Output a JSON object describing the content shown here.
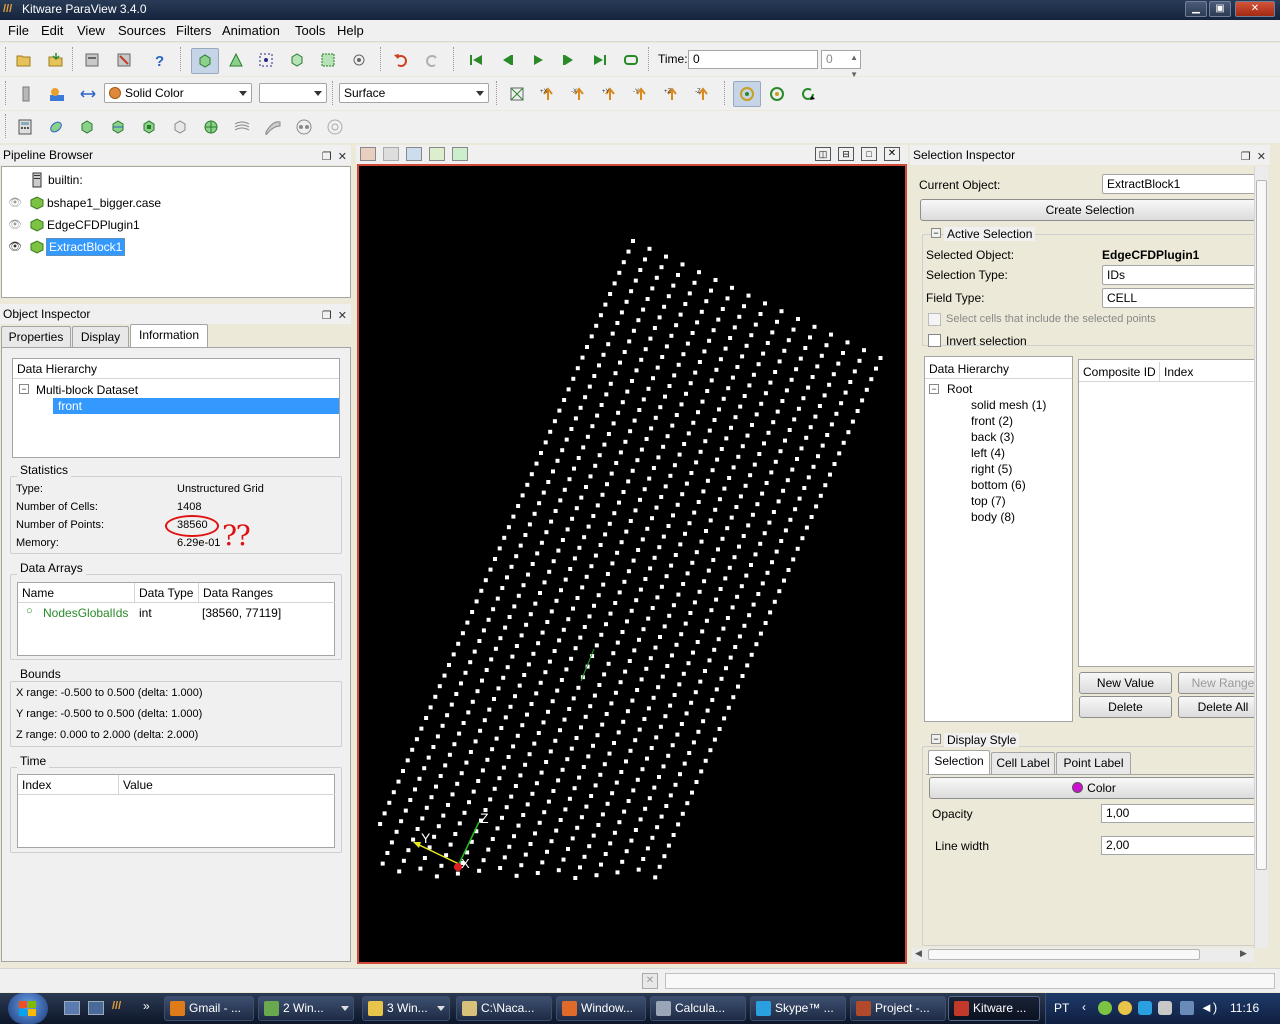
{
  "window": {
    "title": "Kitware ParaView 3.4.0"
  },
  "menu": [
    "File",
    "Edit",
    "View",
    "Sources",
    "Filters",
    "Animation",
    "Tools",
    "Help"
  ],
  "toolbar": {
    "time_label": "Time:",
    "time_value": "0",
    "time_index": "0",
    "color_combo": "Solid Color",
    "component_combo": "",
    "representation_combo": "Surface"
  },
  "pipeline": {
    "title": "Pipeline Browser",
    "items": [
      {
        "label": "builtin:",
        "icon": "server-icon"
      },
      {
        "label": "bshape1_bigger.case",
        "icon": "source-icon"
      },
      {
        "label": "EdgeCFDPlugin1",
        "icon": "source-icon"
      },
      {
        "label": "ExtractBlock1",
        "icon": "source-icon"
      }
    ]
  },
  "object_inspector": {
    "title": "Object Inspector",
    "tabs": [
      "Properties",
      "Display",
      "Information"
    ],
    "hierarchy_header": "Data Hierarchy",
    "hierarchy_root": "Multi-block Dataset",
    "hierarchy_child": "front",
    "statistics": {
      "title": "Statistics",
      "type_label": "Type:",
      "type_value": "Unstructured Grid",
      "cells_label": "Number of Cells:",
      "cells_value": "1408",
      "points_label": "Number of Points:",
      "points_value": "38560",
      "memory_label": "Memory:",
      "memory_value": "6.29e-01",
      "annotation": "⁇"
    },
    "data_arrays": {
      "title": "Data Arrays",
      "headers": [
        "Name",
        "Data Type",
        "Data Ranges"
      ],
      "rows": [
        {
          "name": "NodesGlobalIds",
          "type": "int",
          "range": "[38560, 77119]"
        }
      ]
    },
    "bounds": {
      "title": "Bounds",
      "x": "X range: -0.500 to 0.500 (delta: 1.000)",
      "y": "Y range: -0.500 to 0.500 (delta: 1.000)",
      "z": "Z range: 0.000 to 2.000 (delta: 2.000)"
    },
    "time": {
      "title": "Time",
      "headers": [
        "Index",
        "Value"
      ]
    }
  },
  "axes": {
    "x": "X",
    "y": "Y",
    "z": "Z"
  },
  "selection_inspector": {
    "title": "Selection Inspector",
    "current_object_label": "Current Object:",
    "current_object": "ExtractBlock1",
    "create_selection": "Create Selection",
    "active_selection": "Active Selection",
    "selected_object_label": "Selected Object:",
    "selected_object": "EdgeCFDPlugin1",
    "selection_type_label": "Selection Type:",
    "selection_type": "IDs",
    "field_type_label": "Field Type:",
    "field_type": "CELL",
    "select_cells_points": "Select cells that include the selected points",
    "invert_selection": "Invert selection",
    "hierarchy_header": "Data Hierarchy",
    "hierarchy_root": "Root",
    "hierarchy_items": [
      "solid mesh (1)",
      "front (2)",
      "back (3)",
      "left (4)",
      "right (5)",
      "bottom (6)",
      "top (7)",
      "body (8)"
    ],
    "id_headers": [
      "Composite ID",
      "Index"
    ],
    "new_value": "New Value",
    "new_range": "New Range",
    "delete": "Delete",
    "delete_all": "Delete All",
    "display_style": "Display Style",
    "style_tabs": [
      "Selection",
      "Cell Label",
      "Point Label"
    ],
    "color_button": "Color",
    "color_swatch": "#d010d0",
    "opacity_label": "Opacity",
    "opacity_value": "1,00",
    "line_width_label": "Line width",
    "line_width_value": "2,00"
  },
  "taskbar": {
    "items": [
      {
        "label": "Gmail - ...",
        "color": "#e07b1a"
      },
      {
        "label": "2 Win...",
        "color": "#6aa84f"
      },
      {
        "label": "3 Win...",
        "color": "#e8c44a"
      },
      {
        "label": "C:\\Naca...",
        "color": "#d8c07a"
      },
      {
        "label": "Window...",
        "color": "#e06a2a"
      },
      {
        "label": "Calcula...",
        "color": "#9aa6b8"
      },
      {
        "label": "Skype™ ...",
        "color": "#2aa0e0"
      },
      {
        "label": "Project -...",
        "color": "#b04a2a"
      },
      {
        "label": "Kitware ...",
        "color": "#c0392b"
      }
    ],
    "language": "PT",
    "clock": "11:16"
  }
}
